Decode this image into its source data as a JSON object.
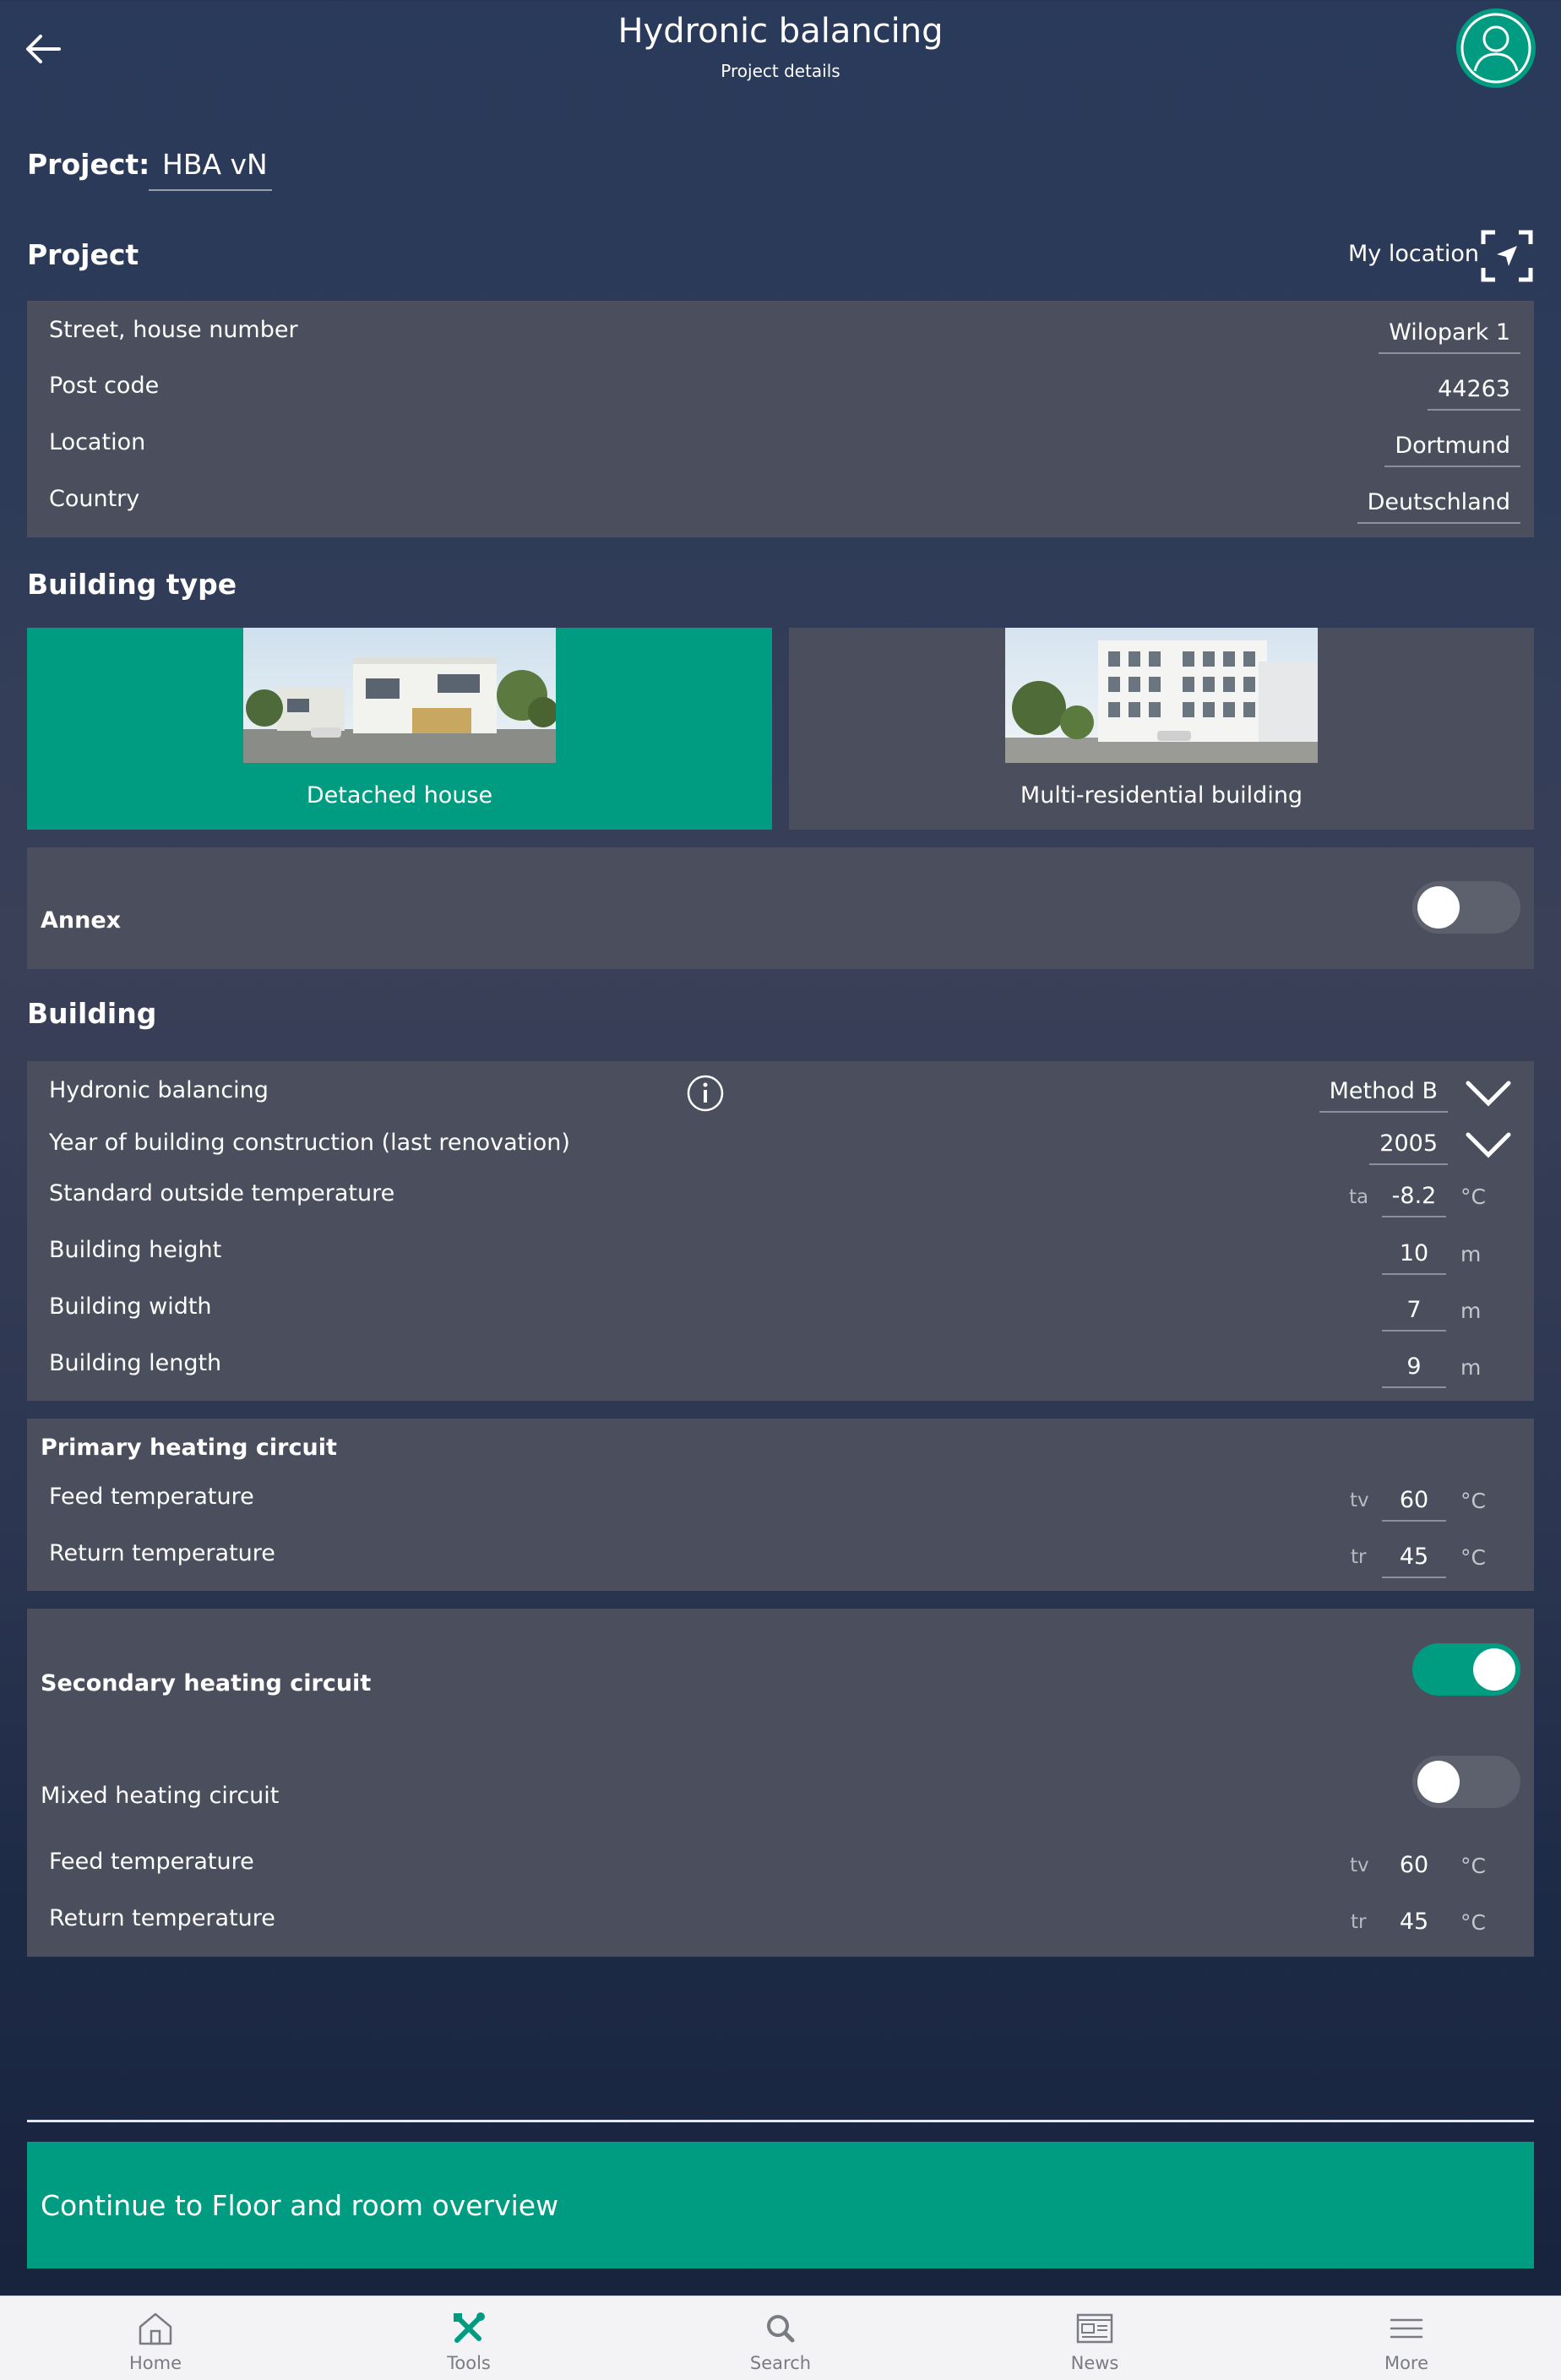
{
  "header": {
    "back_icon": "arrow-left-icon",
    "title": "Hydronic balancing",
    "subtitle": "Project details",
    "avatar_icon": "user-avatar-icon",
    "accent_color": "#009c82"
  },
  "project_name": {
    "label": "Project:",
    "value": "HBA vN"
  },
  "address": {
    "heading": "Project",
    "my_location_label": "My location",
    "my_location_icon": "location-arrow-icon",
    "fields": [
      {
        "label": "Street, house number",
        "value": "Wilopark 1"
      },
      {
        "label": "Post code",
        "value": "44263"
      },
      {
        "label": "Location",
        "value": "Dortmund"
      },
      {
        "label": "Country",
        "value": "Deutschland"
      }
    ]
  },
  "building_type": {
    "heading": "Building type",
    "options": [
      {
        "label": "Detached house",
        "selected": true,
        "image": "detached-house-photo"
      },
      {
        "label": "Multi-residential building",
        "selected": false,
        "image": "apartment-building-photo"
      }
    ]
  },
  "annex": {
    "label": "Annex",
    "enabled": false
  },
  "building": {
    "heading": "Building",
    "hydronic_balancing": {
      "label": "Hydronic balancing",
      "value": "Method B",
      "info_icon": "info-icon"
    },
    "year": {
      "label": "Year of building construction (last renovation)",
      "value": "2005"
    },
    "outside_temp": {
      "label": "Standard outside temperature",
      "symbol": "ta",
      "value": "-8.2",
      "unit": "°C"
    },
    "height": {
      "label": "Building height",
      "value": "10",
      "unit": "m"
    },
    "width": {
      "label": "Building width",
      "value": "7",
      "unit": "m"
    },
    "length": {
      "label": "Building length",
      "value": "9",
      "unit": "m"
    }
  },
  "primary_circuit": {
    "heading": "Primary heating circuit",
    "feed": {
      "label": "Feed temperature",
      "symbol": "tv",
      "value": "60",
      "unit": "°C"
    },
    "return": {
      "label": "Return temperature",
      "symbol": "tr",
      "value": "45",
      "unit": "°C"
    }
  },
  "secondary_circuit": {
    "heading": "Secondary heating circuit",
    "enabled": true,
    "mixed_label": "Mixed heating circuit",
    "mixed_enabled": false,
    "feed": {
      "label": "Feed temperature",
      "symbol": "tv",
      "value": "60",
      "unit": "°C"
    },
    "return": {
      "label": "Return temperature",
      "symbol": "tr",
      "value": "45",
      "unit": "°C"
    }
  },
  "cta": {
    "label": "Continue to Floor and room overview"
  },
  "tabs": [
    {
      "label": "Home",
      "icon": "home-icon"
    },
    {
      "label": "Tools",
      "icon": "tools-icon",
      "active": true
    },
    {
      "label": "Search",
      "icon": "search-icon"
    },
    {
      "label": "News",
      "icon": "news-icon"
    },
    {
      "label": "More",
      "icon": "menu-icon"
    }
  ]
}
